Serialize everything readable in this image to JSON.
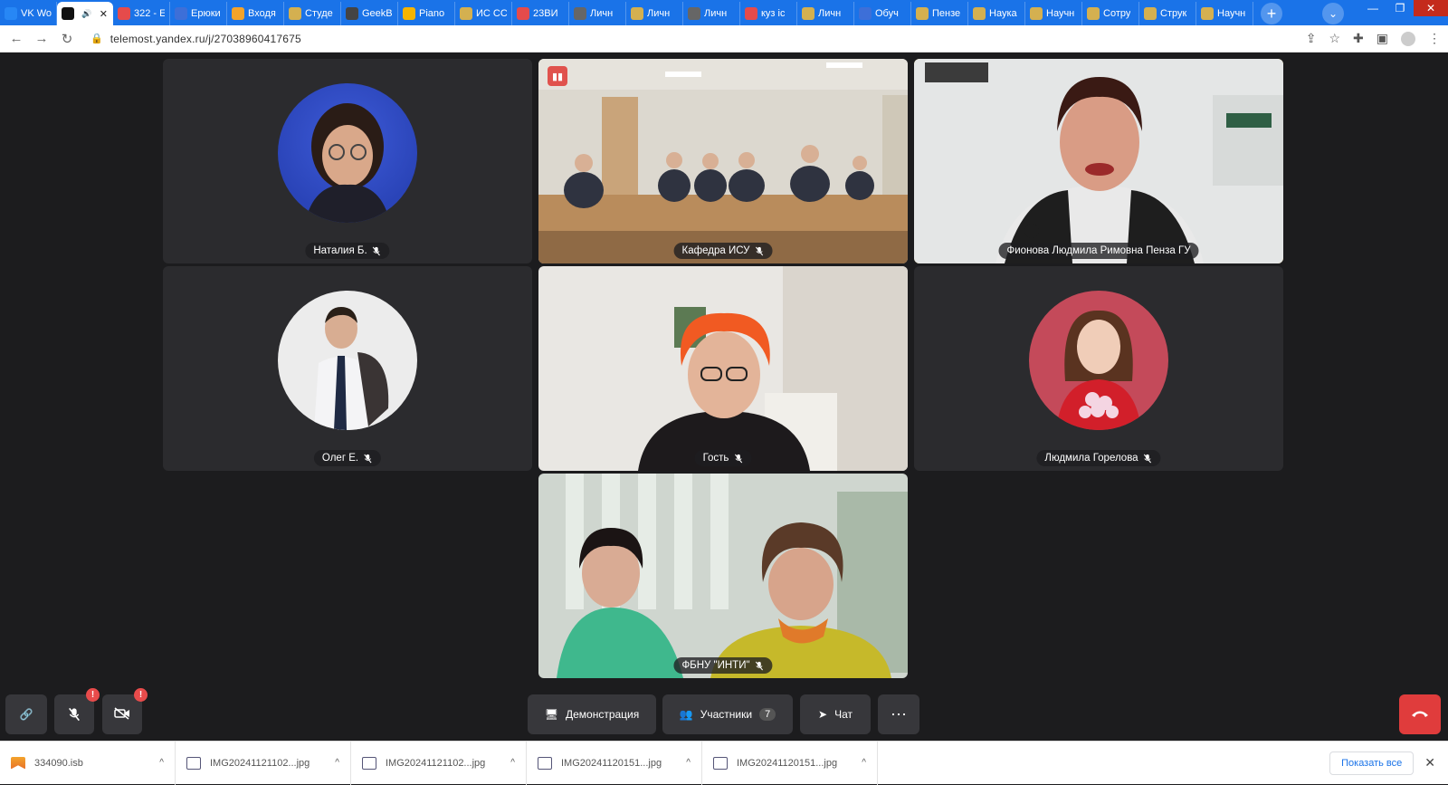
{
  "browser": {
    "tabs": [
      {
        "label": "VK Wo",
        "color": "#2787f5"
      },
      {
        "label": "",
        "color": "#111111",
        "active": true
      },
      {
        "label": "322 - E",
        "color": "#e54b4b"
      },
      {
        "label": "Ерюки",
        "color": "#3d6fd8"
      },
      {
        "label": "Входя",
        "color": "#f3a32b"
      },
      {
        "label": "Студе",
        "color": "#d4b050"
      },
      {
        "label": "GeekB",
        "color": "#444444"
      },
      {
        "label": "Piano",
        "color": "#f5b400"
      },
      {
        "label": "ИС СС",
        "color": "#d4b050"
      },
      {
        "label": "23ВИ",
        "color": "#e54b4b"
      },
      {
        "label": "Личн",
        "color": "#666666"
      },
      {
        "label": "Личн",
        "color": "#d4b050"
      },
      {
        "label": "Личн",
        "color": "#666666"
      },
      {
        "label": "куз іс",
        "color": "#e54b4b"
      },
      {
        "label": "Личн",
        "color": "#d4b050"
      },
      {
        "label": "Обуч",
        "color": "#3d6fd8"
      },
      {
        "label": "Пензе",
        "color": "#d4b050"
      },
      {
        "label": "Наука",
        "color": "#d4b050"
      },
      {
        "label": "Научн",
        "color": "#d4b050"
      },
      {
        "label": "Сотру",
        "color": "#d4b050"
      },
      {
        "label": "Струк",
        "color": "#d4b050"
      },
      {
        "label": "Научн",
        "color": "#d4b050"
      }
    ],
    "url": "telemost.yandex.ru/j/27038960417675"
  },
  "participants": [
    {
      "name": "Наталия Б."
    },
    {
      "name": "Кафедра ИСУ"
    },
    {
      "name": "Фионова Людмила Римовна Пенза ГУ"
    },
    {
      "name": "Олег Е."
    },
    {
      "name": "Гость"
    },
    {
      "name": "Людмила Горелова"
    },
    {
      "name": "ФБНУ \"ИНТИ\""
    }
  ],
  "controls": {
    "mic_badge": "!",
    "camera_badge": "!",
    "demo_label": "Демонстрация",
    "participants_label": "Участники",
    "participants_count": "7",
    "chat_label": "Чат"
  },
  "downloads": {
    "items": [
      {
        "name": "334090.isb"
      },
      {
        "name": "IMG20241121102...jpg"
      },
      {
        "name": "IMG20241121102...jpg"
      },
      {
        "name": "IMG20241120151...jpg"
      },
      {
        "name": "IMG20241120151...jpg"
      }
    ],
    "show_all": "Показать все"
  },
  "colors": {
    "accent": "#1a73e8",
    "speaking_border": "#f5cc49",
    "hangup": "#e03c3c"
  }
}
